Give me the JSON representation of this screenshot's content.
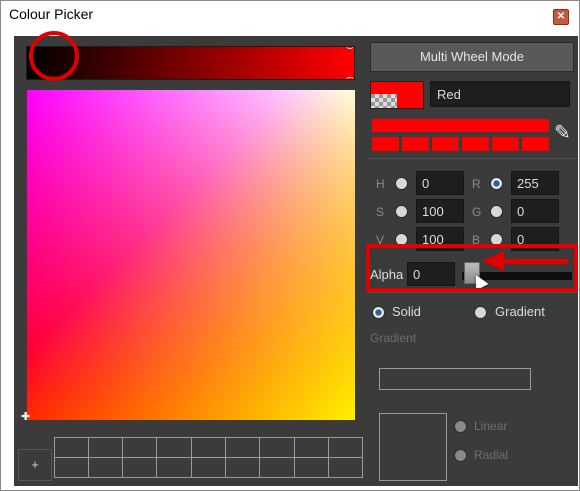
{
  "window": {
    "title": "Colour Picker",
    "close_icon": "close-icon"
  },
  "picker": {
    "multi_wheel_label": "Multi Wheel Mode",
    "color_name": "Red",
    "current_color": "#ff0000",
    "eyedropper_icon": "eyedropper-icon",
    "add_swatch_label": "+"
  },
  "hsv": {
    "h_label": "H",
    "h_value": "0",
    "s_label": "S",
    "s_value": "100",
    "v_label": "V",
    "v_value": "100"
  },
  "rgb": {
    "r_label": "R",
    "r_value": "255",
    "g_label": "G",
    "g_value": "0",
    "b_label": "B",
    "b_value": "0"
  },
  "alpha": {
    "label": "Alpha",
    "value": "0",
    "slider_level": 0
  },
  "fill": {
    "solid_label": "Solid",
    "gradient_label": "Gradient",
    "selected": "Solid"
  },
  "gradient": {
    "section_label": "Gradient",
    "linear_label": "Linear",
    "radial_label": "Radial"
  },
  "colors": {
    "accent": "#ff0000",
    "annotation": "#e00000",
    "panel": "#3b3b3b"
  }
}
